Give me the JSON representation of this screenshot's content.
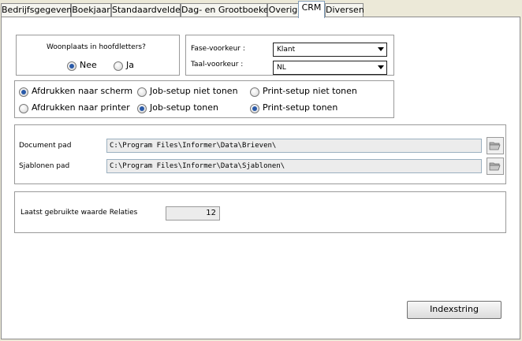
{
  "tabs": [
    {
      "label": "Bedrijfsgegevens"
    },
    {
      "label": "Boekjaar"
    },
    {
      "label": "Standaardvelden"
    },
    {
      "label": "Dag- en Grootboeken"
    },
    {
      "label": "Overig"
    },
    {
      "label": "CRM"
    },
    {
      "label": "Diversen"
    }
  ],
  "woonplaats": {
    "title": "Woonplaats in hoofdletters?",
    "options": [
      {
        "label": "Nee",
        "selected": true
      },
      {
        "label": "Ja",
        "selected": false
      }
    ]
  },
  "voorkeur": {
    "fase_label": "Fase-voorkeur :",
    "fase_value": "Klant",
    "taal_label": "Taal-voorkeur :",
    "taal_value": "NL"
  },
  "print_options": [
    {
      "label": "Afdrukken naar scherm",
      "selected": true
    },
    {
      "label": "Job-setup niet tonen",
      "selected": false
    },
    {
      "label": "Print-setup niet tonen",
      "selected": false
    },
    {
      "label": "Afdrukken naar printer",
      "selected": false
    },
    {
      "label": "Job-setup tonen",
      "selected": true
    },
    {
      "label": "Print-setup tonen",
      "selected": true
    }
  ],
  "paths": {
    "document_label": "Document pad",
    "document_value": "C:\\Program Files\\Informer\\Data\\Brieven\\",
    "sjablonen_label": "Sjablonen pad",
    "sjablonen_value": "C:\\Program Files\\Informer\\Data\\Sjablonen\\"
  },
  "laatst": {
    "label": "Laatst gebruikte waarde Relaties",
    "value": "12"
  },
  "buttons": {
    "indexstring": "Indexstring"
  },
  "icons": {
    "folder": "folder-open-icon",
    "dropdown": "chevron-down-icon"
  }
}
